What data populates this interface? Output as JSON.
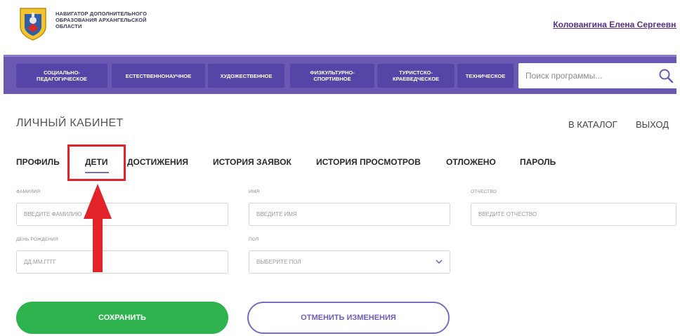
{
  "header": {
    "site_title_lines": [
      "НАВИГАТОР ДОПОЛНИТЕЛЬНОГО",
      "ОБРАЗОВАНИЯ АРХАНГЕЛЬСКОЙ",
      "ОБЛАСТИ"
    ],
    "user_name": "Коловангина Елена Сергеевна"
  },
  "nav": {
    "items": [
      {
        "label": "СОЦИАЛЬНО-ПЕДАГОГИЧЕСКОЕ"
      },
      {
        "label": "ЕСТЕСТВЕННОНАУЧНОЕ"
      },
      {
        "label": "ХУДОЖЕСТВЕННОЕ"
      },
      {
        "label": "ФИЗКУЛЬТУРНО-СПОРТИВНОЕ"
      },
      {
        "label": "ТУРИСТСКО-КРАЕВЕДЧЕСКОЕ"
      },
      {
        "label": "ТЕХНИЧЕСКОЕ"
      }
    ],
    "search_placeholder": "Поиск программы..."
  },
  "page": {
    "title": "ЛИЧНЫЙ КАБИНЕТ",
    "catalog_link": "В КАТАЛОГ",
    "logout_link": "ВЫХОД"
  },
  "tabs": [
    {
      "label": "ПРОФИЛЬ"
    },
    {
      "label": "ДЕТИ",
      "active": true
    },
    {
      "label": "ДОСТИЖЕНИЯ"
    },
    {
      "label": "ИСТОРИЯ ЗАЯВОК"
    },
    {
      "label": "ИСТОРИЯ ПРОСМОТРОВ"
    },
    {
      "label": "ОТЛОЖЕНО"
    },
    {
      "label": "ПАРОЛЬ"
    }
  ],
  "form": {
    "surname": {
      "label": "ФАМИЛИЯ",
      "placeholder": "ВВЕДИТЕ ФАМИЛИЮ"
    },
    "name": {
      "label": "ИМЯ",
      "placeholder": "ВВЕДИТЕ ИМЯ"
    },
    "patronymic": {
      "label": "ОТЧЕСТВО",
      "placeholder": "ВВЕДИТЕ ОТЧЕСТВО"
    },
    "birthday": {
      "label": "ДЕНЬ РОЖДЕНИЯ",
      "placeholder": "ДД.ММ.ГГГГ"
    },
    "gender": {
      "label": "ПОЛ",
      "value": "ВЫБЕРИТЕ ПОЛ"
    }
  },
  "buttons": {
    "save": "СОХРАНИТЬ",
    "cancel": "ОТМЕНИТЬ ИЗМЕНЕНИЯ"
  },
  "colors": {
    "nav_bg": "#6a58b3",
    "nav_button": "#5545a6",
    "save_green": "#2eb34f",
    "accent_purple": "#7c6cc4",
    "highlight_red": "#e2232a"
  },
  "icons": {
    "logo": "coat-of-arms-icon",
    "search": "search-icon",
    "dropdown": "chevron-down-icon",
    "annotation": "red-arrow-icon"
  }
}
